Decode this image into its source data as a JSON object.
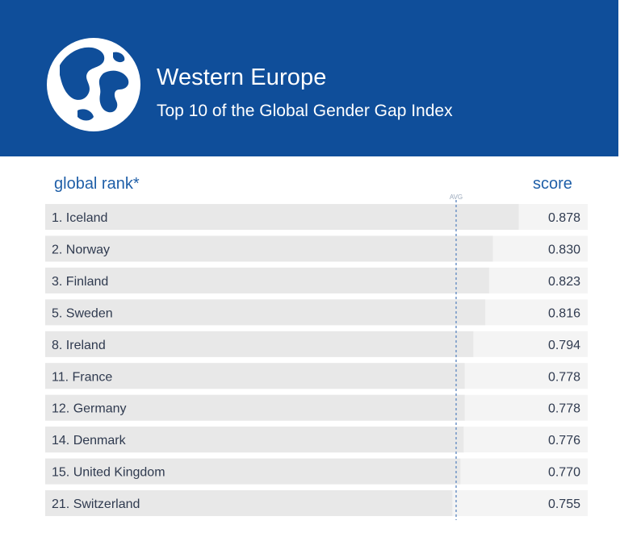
{
  "header": {
    "title": "Western Europe",
    "subtitle": "Top 10 of the Global Gender Gap Index",
    "icon": "globe-icon",
    "background": "#0f4e9a"
  },
  "columns": {
    "rank_label": "global rank*",
    "score_label": "score",
    "avg_label": "AVG"
  },
  "colors": {
    "row_background": "#f4f4f4",
    "bar": "#e8e8e8",
    "text": "#2f3a4f",
    "accent": "#1f5fa8"
  },
  "chart_data": {
    "type": "bar",
    "orientation": "horizontal",
    "categories": [
      "1. Iceland",
      "2. Norway",
      "3. Finland",
      "5. Sweden",
      "8. Ireland",
      "11. France",
      "12. Germany",
      "14. Denmark",
      "15. United Kingdom",
      "21. Switzerland"
    ],
    "values": [
      0.878,
      0.83,
      0.823,
      0.816,
      0.794,
      0.778,
      0.778,
      0.776,
      0.77,
      0.755
    ],
    "value_labels": [
      "0.878",
      "0.830",
      "0.823",
      "0.816",
      "0.794",
      "0.778",
      "0.778",
      "0.776",
      "0.770",
      "0.755"
    ],
    "xlim": [
      0.0,
      1.0
    ],
    "reference_line": {
      "label": "AVG"
    },
    "grid": false
  }
}
